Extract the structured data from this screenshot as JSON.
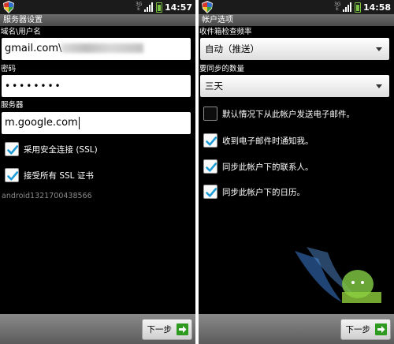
{
  "left_screen": {
    "status": {
      "data_indicator": "3G\nE",
      "time": "14:57"
    },
    "title": "服务器设置",
    "domain_user_label": "域名\\用户名",
    "domain_user_value": "gmail.com\\",
    "password_label": "密码",
    "password_value": "••••••••",
    "server_label": "服务器",
    "server_value": "m.google.com",
    "ssl_label": "采用安全连接 (SSL)",
    "ssl_checked": true,
    "accept_certs_label": "接受所有 SSL 证书",
    "accept_certs_checked": true,
    "device_id": "android1321700438566",
    "next_label": "下一步"
  },
  "right_screen": {
    "status": {
      "data_indicator": "3G\nE",
      "time": "14:58"
    },
    "title": "帐户选项",
    "check_frequency_label": "收件箱检查频率",
    "check_frequency_value": "自动（推送）",
    "sync_amount_label": "要同步的数量",
    "sync_amount_value": "三天",
    "options": [
      {
        "label": "默认情况下从此帐户发送电子邮件。",
        "checked": false
      },
      {
        "label": "收到电子邮件时通知我。",
        "checked": true
      },
      {
        "label": "同步此帐户下的联系人。",
        "checked": true
      },
      {
        "label": "同步此帐户下的日历。",
        "checked": true
      }
    ],
    "next_label": "下一步"
  },
  "icons": {
    "security_shield": "shield-icon",
    "signal": "signal-icon",
    "battery": "battery-icon",
    "next_arrow": "arrow-right-icon",
    "checkmark": "checkmark-icon",
    "dropdown": "chevron-down-icon"
  },
  "colors": {
    "background": "#000000",
    "status_bar": "#1b1b1b",
    "title_bar": "#5a5a5a",
    "checkmark": "#1e9bd6",
    "next_icon": "#2e9a20",
    "device_id_text": "#8a8a8a"
  }
}
